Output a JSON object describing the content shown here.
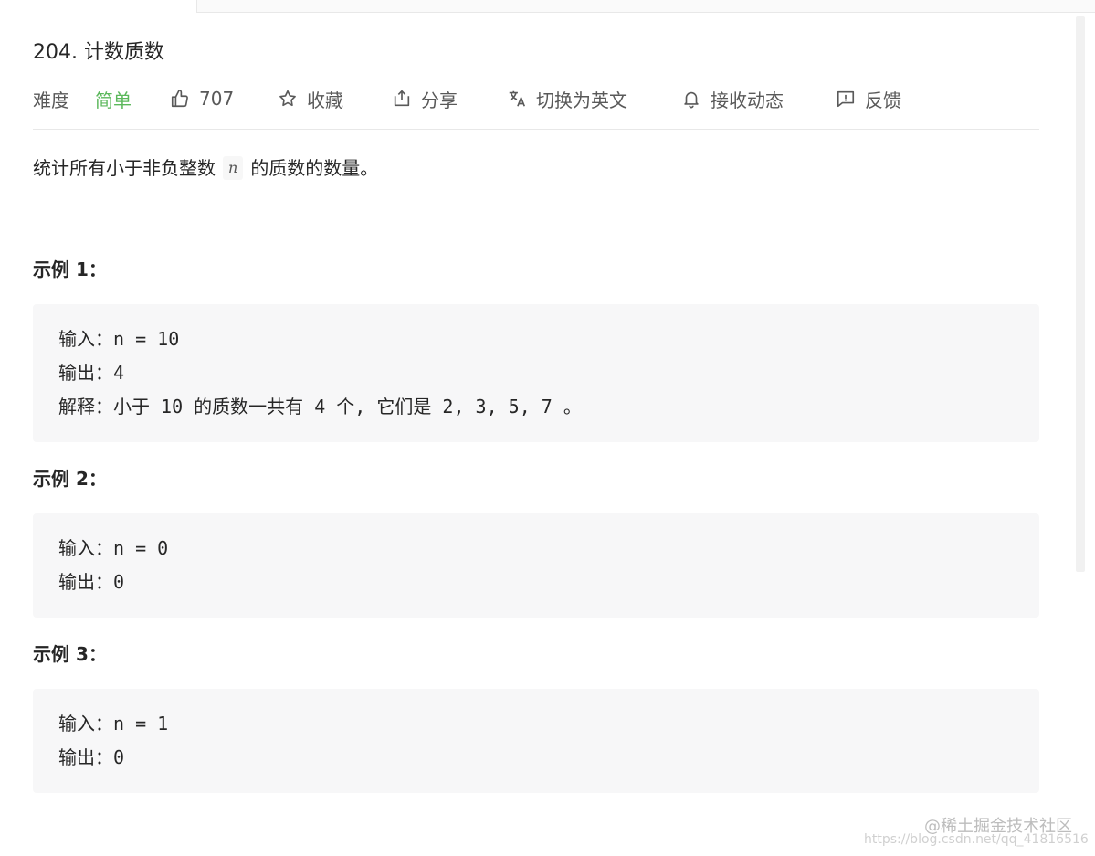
{
  "problem": {
    "title": "204. 计数质数",
    "difficulty_label": "难度",
    "difficulty_value": "简单",
    "likes": "707",
    "favorite_label": "收藏",
    "share_label": "分享",
    "switch_lang_label": "切换为英文",
    "subscribe_label": "接收动态",
    "feedback_label": "反馈",
    "description_before": "统计所有小于非负整数",
    "description_var": "n",
    "description_after": "的质数的数量。"
  },
  "examples": [
    {
      "title": "示例 1：",
      "lines": [
        {
          "label": "输入：",
          "text": "n = 10"
        },
        {
          "label": "输出：",
          "text": "4"
        },
        {
          "label": "解释：",
          "text": "小于 10 的质数一共有 4 个, 它们是 2, 3, 5, 7 。"
        }
      ]
    },
    {
      "title": "示例 2：",
      "lines": [
        {
          "label": "输入：",
          "text": "n = 0"
        },
        {
          "label": "输出：",
          "text": "0"
        }
      ]
    },
    {
      "title": "示例 3：",
      "lines": [
        {
          "label": "输入：",
          "text": "n = 1"
        },
        {
          "label": "输出：",
          "text": "0"
        }
      ]
    }
  ],
  "watermark": {
    "line1": "@稀土掘金技术社区",
    "line2": "https://blog.csdn.net/qq_41816516"
  },
  "icons": {
    "like": "thumbs-up-icon",
    "favorite": "star-icon",
    "share": "share-icon",
    "translate": "translate-icon",
    "subscribe": "bell-icon",
    "feedback": "feedback-icon"
  },
  "colors": {
    "difficulty_easy": "#5cb85c",
    "example_bg": "#f7f7f8"
  }
}
